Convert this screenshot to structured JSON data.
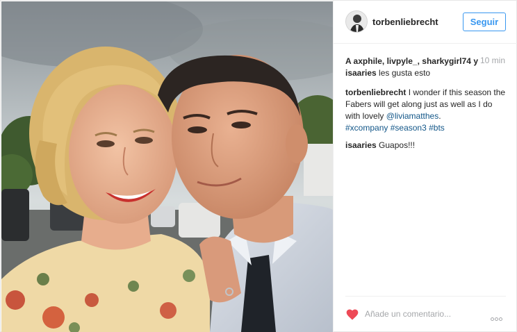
{
  "post": {
    "photo_alt": "",
    "author": {
      "username": "torbenliebrecht",
      "follow_label": "Seguir"
    },
    "likes": {
      "names": "A axphile, livpyle_, sharkygirl74 y isaaries",
      "suffix": " les gusta esto"
    },
    "time": "10 min",
    "caption": {
      "author": "torbenliebrecht",
      "text": " I wonder if this season the Fabers will get along just as well as I do with lovely ",
      "mention": "@liviamatthes",
      "text_end": ".",
      "hashtags": [
        "#xcompany",
        "#season3",
        "#bts"
      ]
    },
    "comments": [
      {
        "author": "isaaries",
        "text": " Guapos!!!"
      }
    ],
    "footer": {
      "comment_placeholder": "Añade un comentario...",
      "like_icon": "heart-icon",
      "more_icon": "more-options-icon"
    },
    "colors": {
      "link": "#125688",
      "button": "#3897f0",
      "heart": "#ed4956"
    }
  }
}
